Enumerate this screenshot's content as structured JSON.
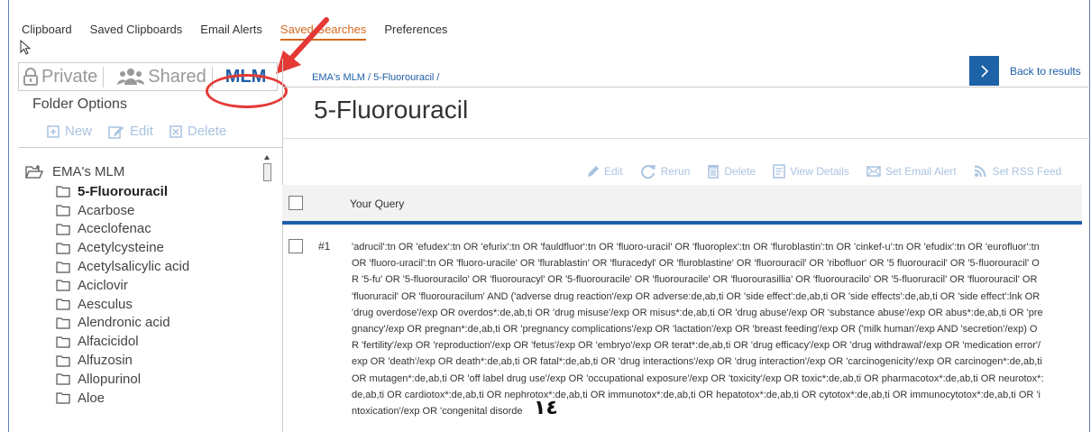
{
  "top_nav": {
    "items": [
      "Clipboard",
      "Saved Clipboards",
      "Email Alerts",
      "Saved Searches",
      "Preferences"
    ],
    "active": "Saved Searches"
  },
  "scope_tabs": {
    "private": "Private",
    "shared": "Shared",
    "mlm": "MLM"
  },
  "folder_options": {
    "title": "Folder Options",
    "new": "New",
    "edit": "Edit",
    "delete": "Delete"
  },
  "tree": {
    "root": "EMA's MLM",
    "items": [
      "5-Fluorouracil",
      "Acarbose",
      "Aceclofenac",
      "Acetylcysteine",
      "Acetylsalicylic acid",
      "Aciclovir",
      "Aesculus",
      "Alendronic acid",
      "Alfacicidol",
      "Alfuzosin",
      "Allopurinol",
      "Aloe"
    ],
    "selected": "5-Fluorouracil"
  },
  "breadcrumb": "EMA's MLM / 5-Fluorouracil /",
  "back_to_results": "Back to results",
  "page_title": "5-Fluorouracil",
  "toolbar": {
    "edit": "Edit",
    "rerun": "Rerun",
    "delete": "Delete",
    "view_details": "View Details",
    "set_email_alert": "Set Email Alert",
    "set_rss_feed": "Set RSS Feed"
  },
  "table": {
    "header": "Your Query",
    "rows": [
      {
        "num": "#1",
        "query": "'adrucil':tn OR 'efudex':tn OR 'efurix':tn OR 'fauldfluor':tn OR 'fluoro-uracil' OR 'fluoroplex':tn OR 'fluroblastin':tn OR 'cinkef-u':tn OR 'efudix':tn OR 'eurofluor':tn OR 'fluoro-uracil':tn OR 'fluoro-uracile' OR 'flurablastin' OR 'fluracedyl' OR 'fluroblastine' OR 'fluorouracil' OR 'ribofluor' OR '5 fluorouracil' OR '5-fluorouracil' OR '5-fu' OR '5-fluorouracilo' OR 'fluorouracyl' OR '5-fluorouracile' OR 'fluorouracile' OR 'fluorourasillia' OR 'fluorouracilo' OR '5-fluoruracil' OR 'fluorouracil' OR 'fluoruracil' OR 'fluorouracilum' AND ('adverse drug reaction'/exp OR adverse:de,ab,ti OR 'side effect':de,ab,ti OR 'side effects':de,ab,ti OR 'side effect':lnk OR 'drug overdose'/exp OR overdos*:de,ab,ti OR 'drug misuse'/exp OR misus*:de,ab,ti OR 'drug abuse'/exp OR 'substance abuse'/exp OR abus*:de,ab,ti OR 'pregnancy'/exp OR pregnan*:de,ab,ti OR 'pregnancy complications'/exp OR 'lactation'/exp OR 'breast feeding'/exp OR ('milk human'/exp AND 'secretion'/exp) OR 'fertility'/exp OR 'reproduction'/exp OR 'fetus'/exp OR 'embryo'/exp OR terat*:de,ab,ti OR 'drug efficacy'/exp OR 'drug withdrawal'/exp OR 'medication error'/exp OR 'death'/exp OR death*:de,ab,ti OR fatal*:de,ab,ti OR 'drug interactions'/exp OR 'drug interaction'/exp OR 'carcinogenicity'/exp OR carcinogen*:de,ab,ti OR mutagen*:de,ab,ti OR 'off label drug use'/exp OR 'occupational exposure'/exp OR 'toxicity'/exp OR toxic*:de,ab,ti OR pharmacotox*:de,ab,ti OR neurotox*:de,ab,ti OR cardiotox*:de,ab,ti OR nephrotox*:de,ab,ti OR immunotox*:de,ab,ti OR hepatotox*:de,ab,ti OR cytotox*:de,ab,ti OR immunocytotox*:de,ab,ti OR 'intoxication'/exp OR 'congenital disorde"
      }
    ]
  },
  "overlay_mark": "١٤",
  "colors": {
    "accent": "#1e62a8",
    "active_tab": "#d46a1f",
    "annotation": "#e53935",
    "disabled_action": "#a9c3e0"
  }
}
